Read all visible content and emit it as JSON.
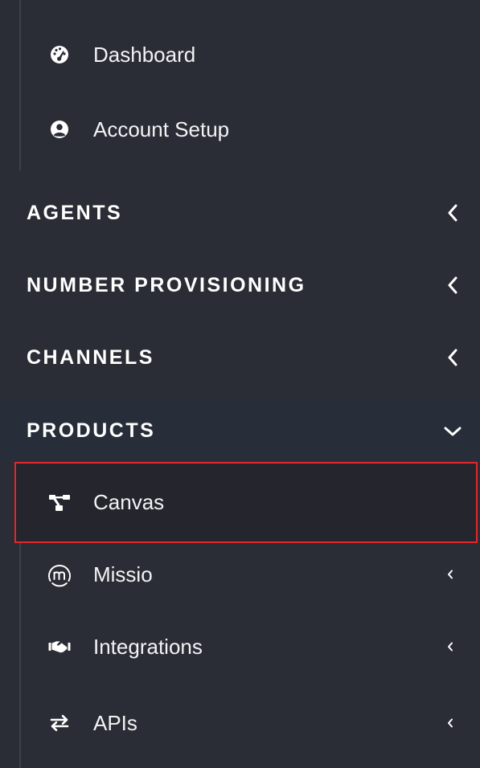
{
  "menu": {
    "top_items": [
      {
        "label": "Dashboard",
        "icon": "tachometer-icon"
      },
      {
        "label": "Account Setup",
        "icon": "user-circle-icon"
      }
    ],
    "sections": [
      {
        "label": "AGENTS",
        "expanded": false
      },
      {
        "label": "NUMBER PROVISIONING",
        "expanded": false
      },
      {
        "label": "CHANNELS",
        "expanded": false
      },
      {
        "label": "PRODUCTS",
        "expanded": true
      }
    ],
    "product_items": [
      {
        "label": "Canvas",
        "icon": "sitemap-icon",
        "selected": true
      },
      {
        "label": "Missio",
        "icon": "missio-logo-icon",
        "has_submenu": true
      },
      {
        "label": "Integrations",
        "icon": "handshake-icon",
        "has_submenu": true
      },
      {
        "label": "APIs",
        "icon": "exchange-arrows-icon",
        "has_submenu": true
      }
    ]
  },
  "colors": {
    "background": "#2b2d36",
    "products_header_bg": "#272d39",
    "selected_item_bg": "#24252d",
    "highlight_border": "#e6262b",
    "rail": "#3a4150"
  }
}
